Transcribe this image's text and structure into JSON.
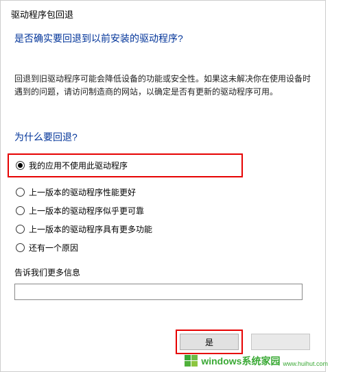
{
  "dialog": {
    "title": "驱动程序包回退",
    "main_question": "是否确实要回退到以前安装的驱动程序?",
    "info_text": "回退到旧驱动程序可能会降低设备的功能或安全性。如果这未解决你在使用设备时遇到的问题，请访问制造商的网站，以确定是否有更新的驱动程序可用。",
    "sub_question": "为什么要回退?",
    "options": [
      {
        "label": "我的应用不使用此驱动程序",
        "selected": true,
        "highlighted": true
      },
      {
        "label": "上一版本的驱动程序性能更好",
        "selected": false,
        "highlighted": false
      },
      {
        "label": "上一版本的驱动程序似乎更可靠",
        "selected": false,
        "highlighted": false
      },
      {
        "label": "上一版本的驱动程序具有更多功能",
        "selected": false,
        "highlighted": false
      },
      {
        "label": "还有一个原因",
        "selected": false,
        "highlighted": false
      }
    ],
    "tell_more_label": "告诉我们更多信息",
    "textbox_value": "",
    "buttons": {
      "yes": "是",
      "no": ""
    }
  },
  "watermark": {
    "brand": "windows",
    "suffix": "系统家园",
    "url": "www.huihut.com"
  }
}
